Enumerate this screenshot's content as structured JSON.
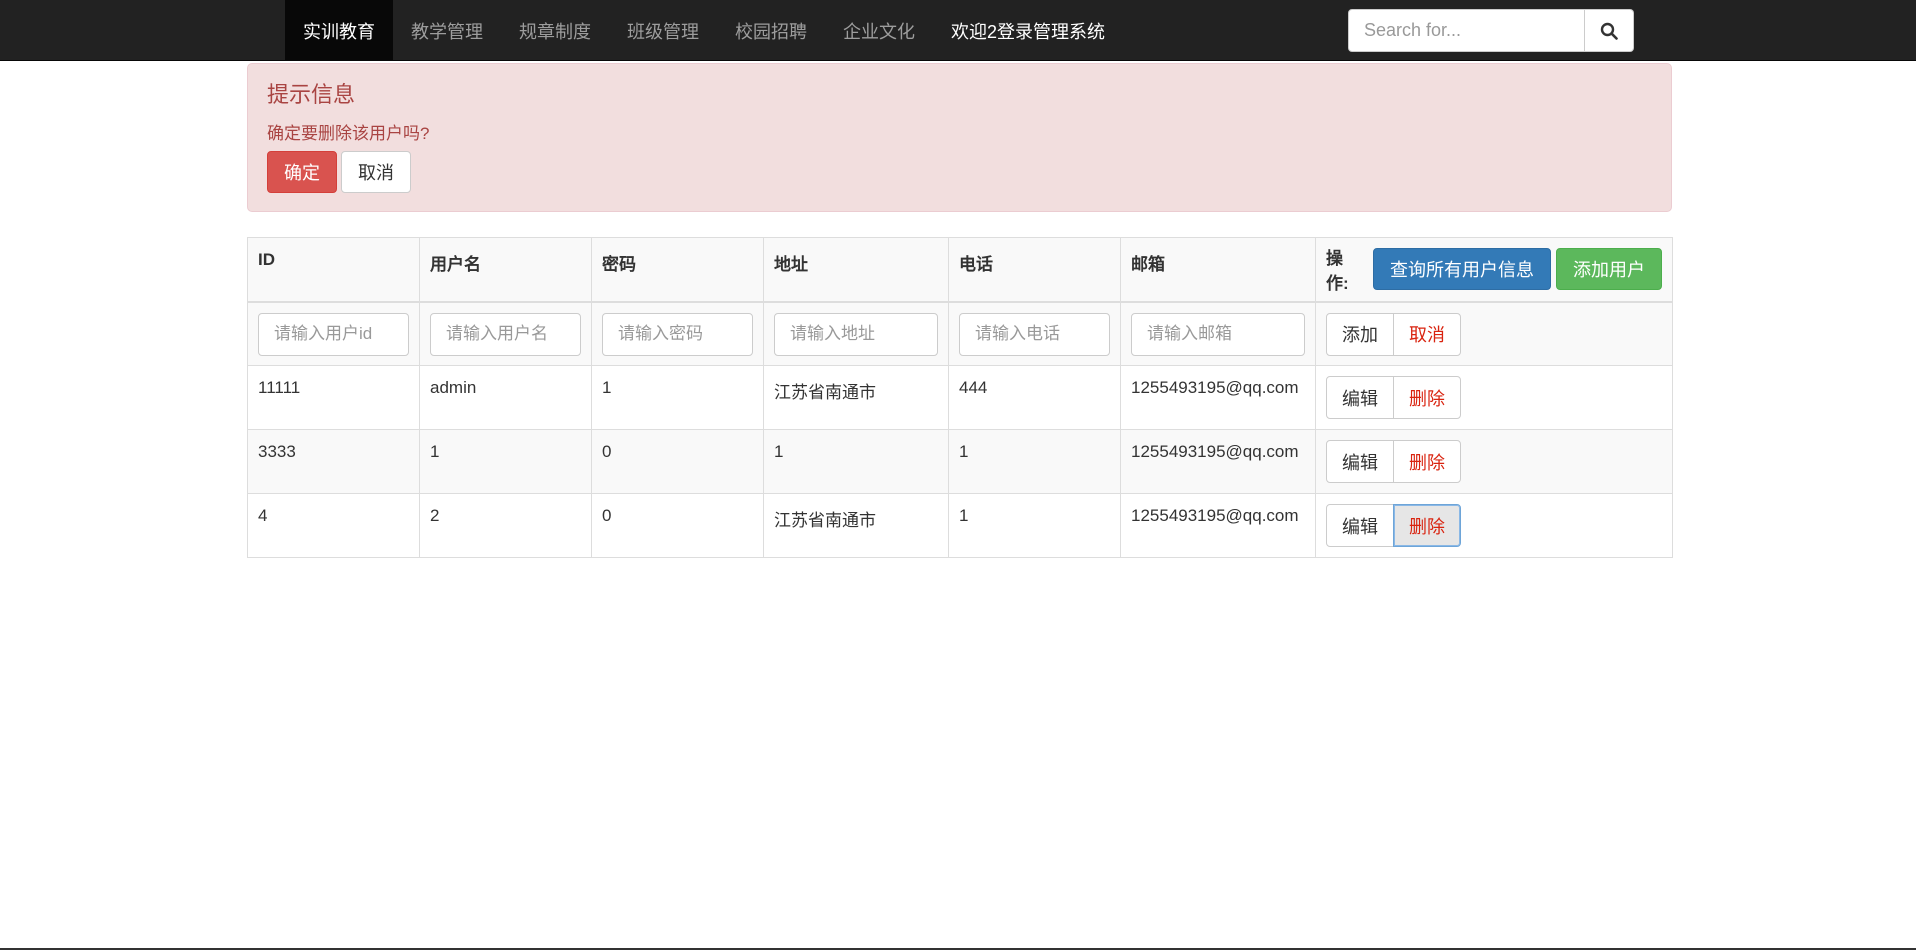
{
  "navbar": {
    "brand": "实训教育",
    "items": [
      "教学管理",
      "规章制度",
      "班级管理",
      "校园招聘",
      "企业文化"
    ],
    "welcome": "欢迎2登录管理系统",
    "search": {
      "placeholder": "Search for...",
      "value": ""
    }
  },
  "alert": {
    "title": "提示信息",
    "message": "确定要删除该用户吗?",
    "confirm_label": "确定",
    "cancel_label": "取消"
  },
  "table": {
    "headers": {
      "id": "ID",
      "username": "用户名",
      "password": "密码",
      "address": "地址",
      "phone": "电话",
      "email": "邮箱",
      "ops": "操作:"
    },
    "query_all_label": "查询所有用户信息",
    "add_user_label": "添加用户",
    "input_row": {
      "placeholders": {
        "id": "请输入用户id",
        "username": "请输入用户名",
        "password": "请输入密码",
        "address": "请输入地址",
        "phone": "请输入电话",
        "email": "请输入邮箱"
      },
      "add_label": "添加",
      "cancel_label": "取消"
    },
    "row_actions": {
      "edit_label": "编辑",
      "delete_label": "删除"
    },
    "rows": [
      {
        "id": "11111",
        "username": "admin",
        "password": "1",
        "address": "江苏省南通市",
        "phone": "444",
        "email": "1255493195@qq.com"
      },
      {
        "id": "3333",
        "username": "1",
        "password": "0",
        "address": "1",
        "phone": "1",
        "email": "1255493195@qq.com"
      },
      {
        "id": "4",
        "username": "2",
        "password": "0",
        "address": "江苏省南通市",
        "phone": "1",
        "email": "1255493195@qq.com"
      }
    ]
  },
  "colors": {
    "navbar_bg": "#222222",
    "alert_bg": "#f2dede",
    "alert_text": "#a94442",
    "danger": "#d9534f",
    "primary": "#337ab7",
    "success": "#5cb85c",
    "delete_text": "#d9230f"
  },
  "icons": {
    "search_button": "search-icon"
  }
}
